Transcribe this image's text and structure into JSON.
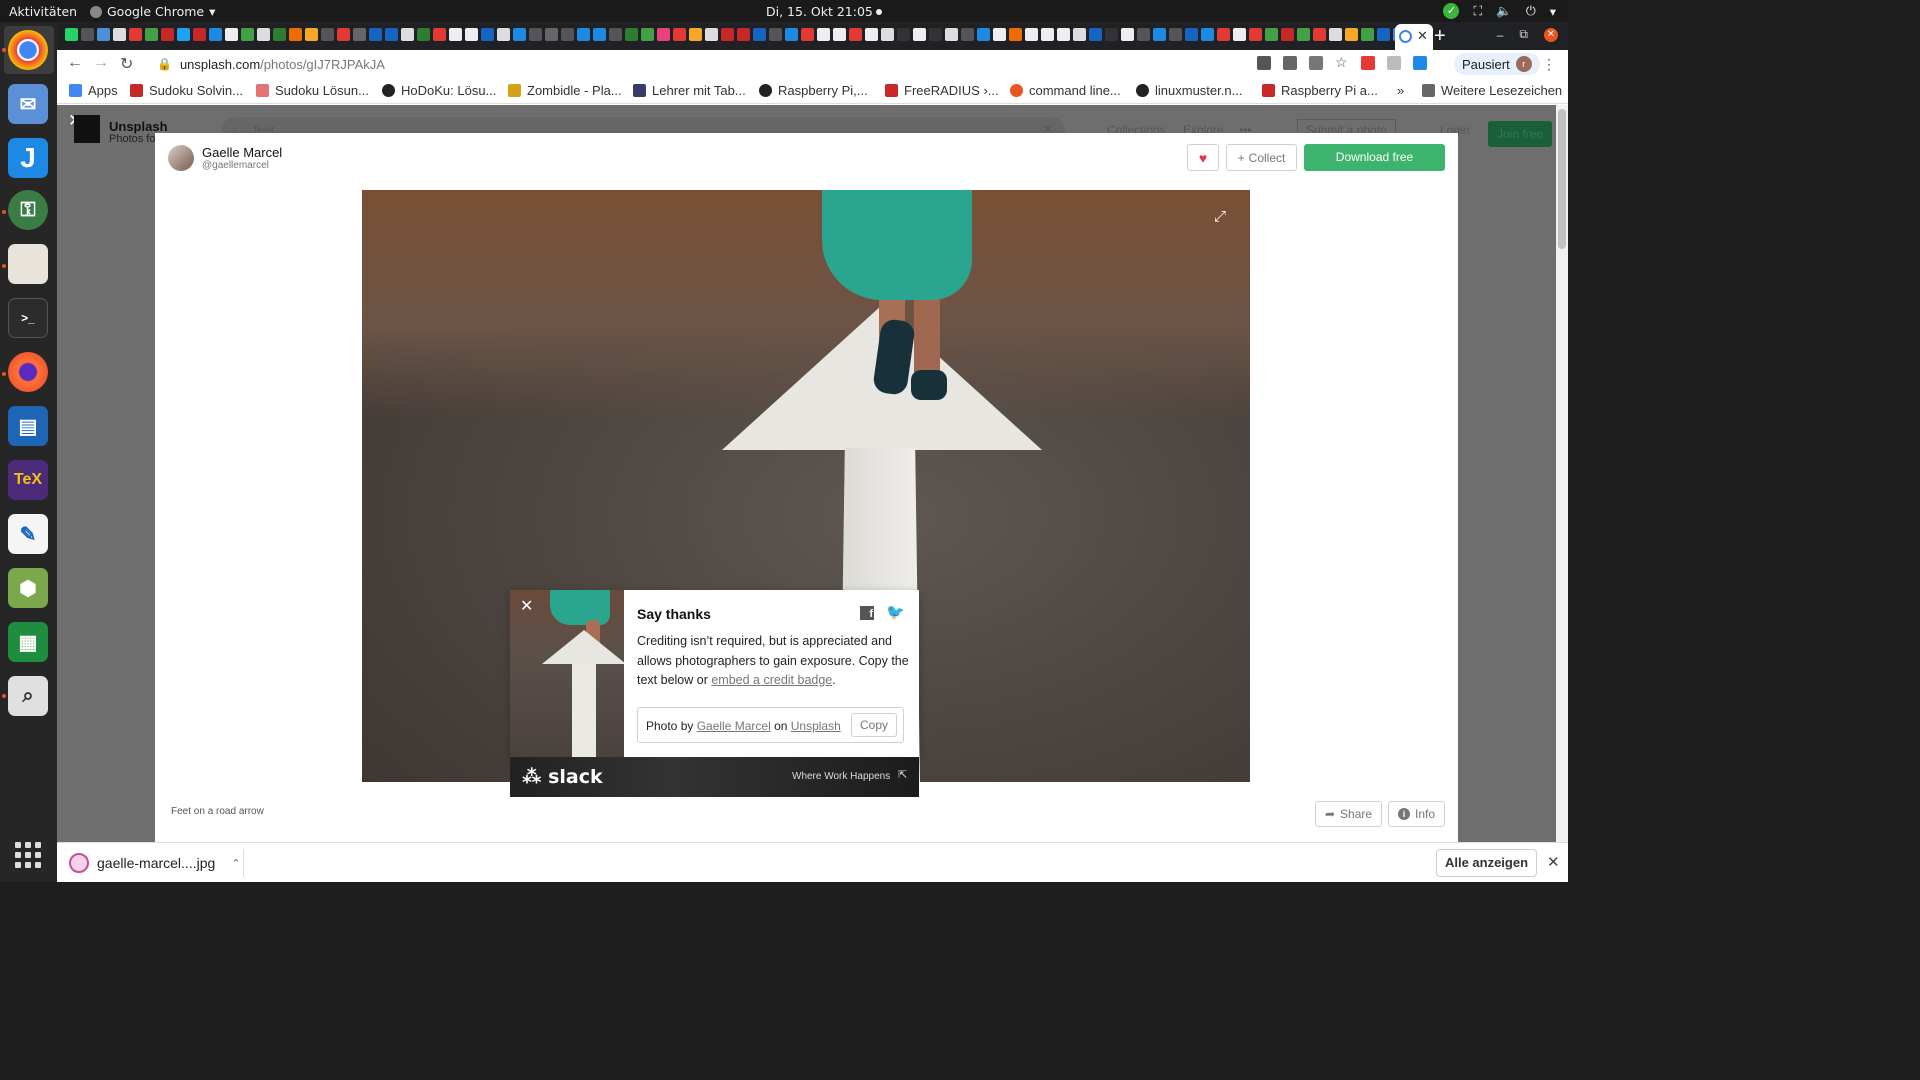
{
  "system": {
    "activities": "Aktivitäten",
    "app_name": "Google Chrome",
    "clock": "Di, 15. Okt  21:05"
  },
  "browser": {
    "url_host": "unsplash.com",
    "url_path": "/photos/gIJ7RJPAkJA",
    "profile_label": "Pausiert",
    "profile_initial": "r",
    "bookmarks": [
      {
        "label": "Apps",
        "icon": "apps-grid-icon",
        "color": "#4285f4"
      },
      {
        "label": "Sudoku Solvin...",
        "icon": "sudoku-icon",
        "color": "#c62828"
      },
      {
        "label": "Sudoku Lösun...",
        "icon": "sudoku2-icon",
        "color": "#e57373"
      },
      {
        "label": "HoDoKu: Lösu...",
        "icon": "github-icon",
        "color": "#222222"
      },
      {
        "label": "Zombidle - Pla...",
        "icon": "shield-icon",
        "color": "#d4a017"
      },
      {
        "label": "Lehrer mit Tab...",
        "icon": "tablet-icon",
        "color": "#3a3a6a"
      },
      {
        "label": "Raspberry Pi,...",
        "icon": "github-icon",
        "color": "#222222"
      },
      {
        "label": "FreeRADIUS ›...",
        "icon": "radius-icon",
        "color": "#c62828"
      },
      {
        "label": "command line...",
        "icon": "askubuntu-icon",
        "color": "#e95420"
      },
      {
        "label": "linuxmuster.n...",
        "icon": "github-icon",
        "color": "#222222"
      },
      {
        "label": "Raspberry Pi a...",
        "icon": "raspberry-icon",
        "color": "#c62828"
      }
    ],
    "bookmarks_more": "»",
    "other_bookmarks": "Weitere Lesezeichen"
  },
  "background_page": {
    "brand": "Unsplash",
    "subtitle": "Photos fo",
    "search_value": "feet",
    "nav": [
      "Collections",
      "Explore",
      "•••",
      "Submit a photo",
      "Login"
    ],
    "join": "Join free"
  },
  "modal": {
    "author_name": "Gaelle Marcel",
    "author_handle": "@gaellemarcel",
    "collect_label": "Collect",
    "download_label": "Download free",
    "caption": "Feet on a road arrow",
    "share_label": "Share",
    "info_label": "Info"
  },
  "say_thanks": {
    "title": "Say thanks",
    "body_before_link": "Crediting isn’t required, but is appreciated and allows photographers to gain exposure. Copy the text below or ",
    "link": "embed a credit badge",
    "body_after_link": ".",
    "credit_prefix": "Photo by ",
    "credit_author": "Gaelle Marcel",
    "credit_mid": " on ",
    "credit_site": "Unsplash",
    "copy_label": "Copy"
  },
  "ad": {
    "brand": "slack",
    "tagline": "Where Work Happens"
  },
  "downloads": {
    "file_name": "gaelle-marcel....jpg",
    "show_all": "Alle anzeigen"
  },
  "colors": {
    "download_green": "#3cb46e",
    "heart_red": "#e8344c",
    "teal_cloth": "#2aa58f"
  }
}
